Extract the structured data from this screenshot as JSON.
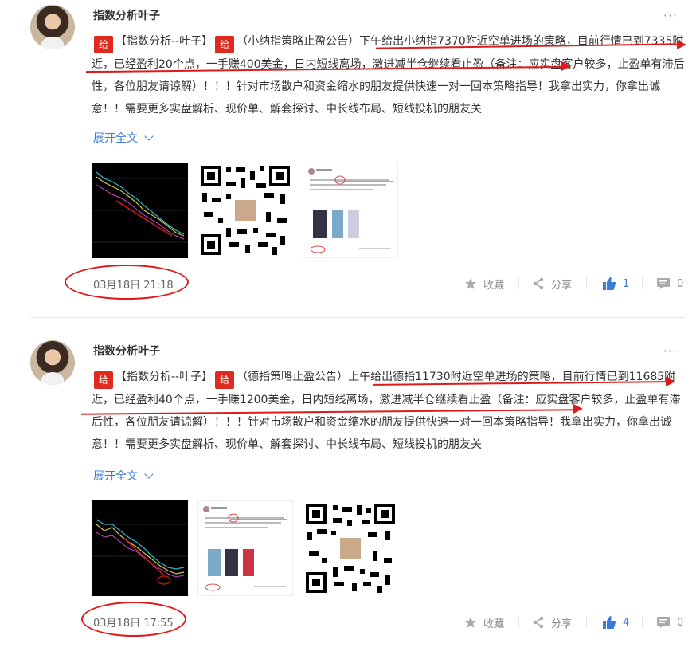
{
  "posts": [
    {
      "author": "指数分析叶子",
      "more": "···",
      "tag_glyph": "给",
      "title_bracket": "【指数分析--叶子】",
      "body": "（小纳指策略止盈公告）下午给出小纳指7370附近空单进场的策略，目前行情已到7335附近，已经盈利20个点，一手赚400美金，日内短线离场，激进减半仓继续看止盈（备注：应实盘客户较多，止盈单有滞后性，各位朋友请谅解）！！！针对市场散户和资金缩水的朋友提供快速一对一回本策略指导！我拿出实力，你拿出诚意！！需要更多实盘解析、现价单、解套探讨、中长线布局、短线投机的朋友关",
      "expand": "展开全文",
      "date": "03月18日 21:18",
      "actions": {
        "fav": "收藏",
        "share": "分享",
        "likes": "1",
        "comments": "0"
      }
    },
    {
      "author": "指数分析叶子",
      "more": "···",
      "tag_glyph": "给",
      "title_bracket": "【指数分析--叶子】",
      "body": "（德指策略止盈公告）上午给出德指11730附近空单进场的策略，目前行情已到11685附近，已经盈利40个点，一手赚1200美金，日内短线离场，激进减半仓继续看止盈（备注：应实盘客户较多，止盈单有滞后性，各位朋友请谅解）！！！针对市场散户和资金缩水的朋友提供快速一对一回本策略指导！我拿出实力，你拿出诚意！！需要更多实盘解析、现价单、解套探讨、中长线布局、短线投机的朋友关",
      "expand": "展开全文",
      "date": "03月18日 17:55",
      "actions": {
        "fav": "收藏",
        "share": "分享",
        "likes": "4",
        "comments": "0"
      }
    }
  ],
  "colors": {
    "accent": "#3a7bd5",
    "tag": "#e02a1f",
    "annotation": "#e0191a"
  },
  "icons": [
    "more-icon",
    "chevron-down-icon",
    "star-icon",
    "share-icon",
    "thumbs-up-icon",
    "comment-icon"
  ]
}
